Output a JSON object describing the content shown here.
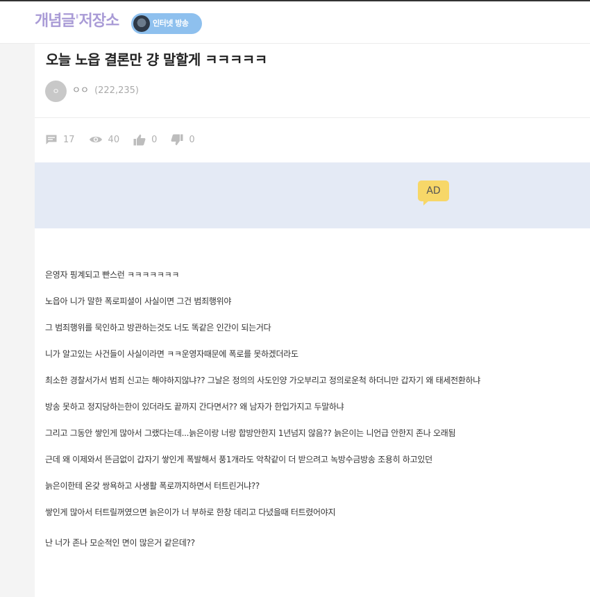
{
  "header": {
    "logo_text": "개념글",
    "logo_quote": "'",
    "logo_text2": "저장소",
    "live_badge_label": "인터넷 방송"
  },
  "post": {
    "title": "오늘 노읍 결론만 걍 말할게 ㅋㅋㅋㅋㅋ",
    "author_avatar_text": "ㅇ",
    "author_name": "ㅇㅇ",
    "author_points": "(222,235)",
    "stats": {
      "comments": "17",
      "views": "40",
      "likes": "0",
      "dislikes": "0"
    },
    "ad_label": "AD",
    "lines": [
      "은영자 핑계되고 빤스런 ㅋㅋㅋㅋㅋㅋㅋ",
      "노읍아 니가 말한 폭로피셜이 사실이면 그건 범죄행위야",
      "그 범죄행위를 묵인하고 방관하는것도 너도 똑같은 인간이 되는거다",
      "니가 알고있는 사건들이 사실이라면 ㅋㅋ운영자때문에 폭로를 못하겠더라도",
      "최소한 경찰서가서 범죄 신고는 해야하지않냐?? 그날은 정의의 사도인양 가오부리고 정의로운척 하더니만 갑자기 왜 태세전환하냐",
      "방송 못하고 정지당하는한이 있더라도 끝까지 간다면서?? 왜 남자가 한입가지고 두말하냐",
      "그리고 그동안 쌓인게 많아서 그랬다는데...늙은이랑 너랑 합방안한지 1년넘지 않음?? 늙은이는 니언급 안한지 존나 오래됨",
      "근데 왜 이제와서 뜬금없이 갑자기 쌓인게 폭발해서 풍1개라도 악착같이 더 받으려고 녹방수금방송 조용히 하고있던",
      "늙은이한테 온갖 쌍욕하고 사생활 폭로까지하면서 터트린거냐??",
      "쌓인게 많아서 터트릴꺼였으면 늙은이가 너 부하로 한창 데리고 다녔을때 터트렸어야지",
      "난 너가 존나 모순적인 면이 많은거 같은데??"
    ]
  },
  "colors": {
    "logo": "#a99bd6",
    "live_badge": "#8ec0ee",
    "ad_background": "#e4eaf5",
    "ad_badge": "#f7d768"
  },
  "icons": [
    "comment-icon",
    "eye-icon",
    "thumbs-up-icon",
    "thumbs-down-icon"
  ]
}
